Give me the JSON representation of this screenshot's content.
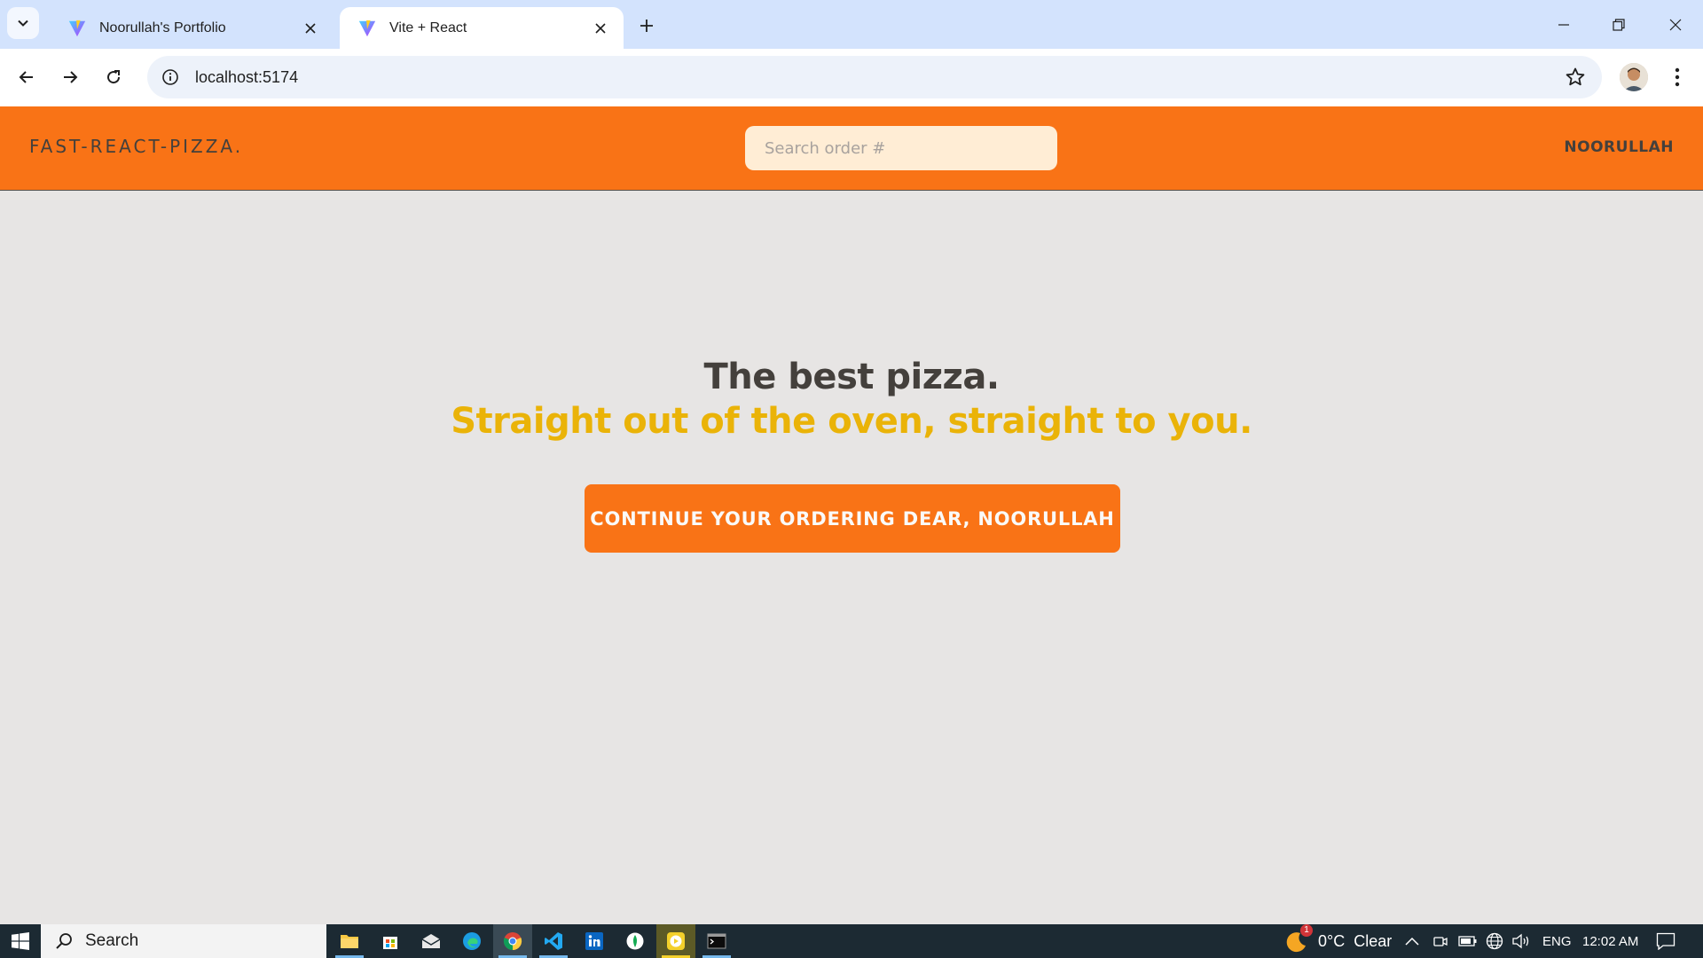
{
  "browser": {
    "tabs": [
      {
        "title": "Noorullah's Portfolio",
        "icon": "vite-icon",
        "active": false
      },
      {
        "title": "Vite + React",
        "icon": "vite-icon",
        "active": true
      }
    ],
    "url": "localhost:5174"
  },
  "app": {
    "logo": "Fast-React-Pizza.",
    "search_placeholder": "Search order #",
    "username": "Noorullah",
    "hero_title": "The best pizza.",
    "hero_subtitle": "Straight out of the oven, straight to you.",
    "cta_label": "Continue your ordering dear, Noorullah",
    "colors": {
      "brand": "#f97316",
      "accent": "#eab308",
      "background": "#e7e5e4"
    }
  },
  "taskbar": {
    "search_label": "Search",
    "weather_badge": "1",
    "weather": "0°C  Clear",
    "language": "ENG",
    "time": "12:02 AM"
  }
}
